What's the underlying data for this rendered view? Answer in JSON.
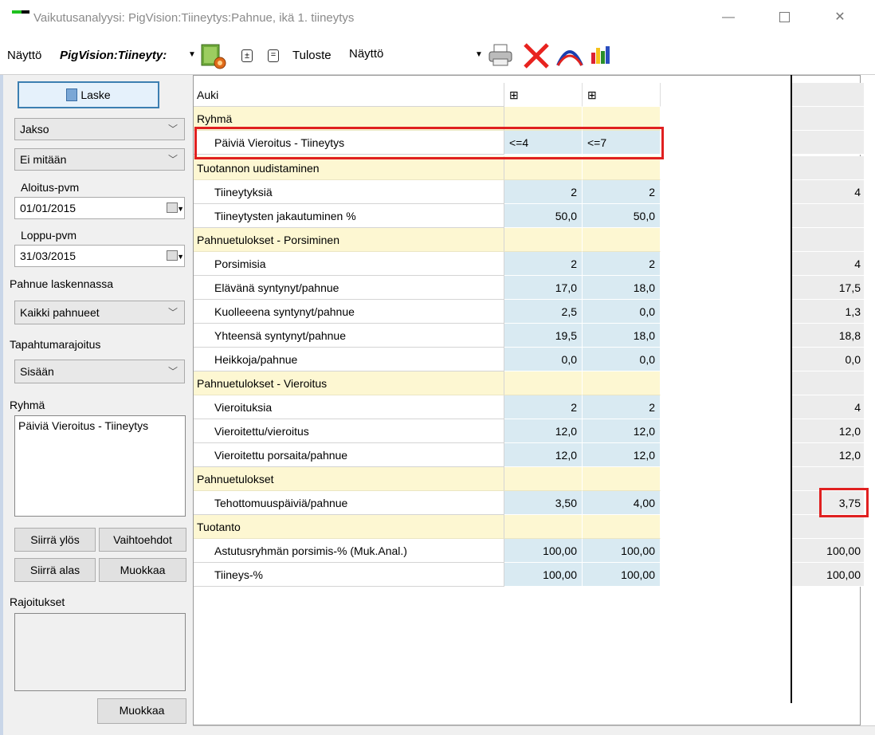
{
  "window": {
    "title": "Vaikutusanalyysi: PigVision:Tiineytys:Pahnue, ikä 1. tiineytys",
    "minimize": "—",
    "close": "✕"
  },
  "toolbar": {
    "view_label": "Näyttö",
    "profile": "PigVision:Tiineyty:",
    "expand": "±",
    "collapse": "=",
    "print_label": "Tuloste",
    "output": "Näyttö",
    "icons": [
      "gear-icon",
      "expand-icon",
      "collapse-icon",
      "printer-icon",
      "delete-icon",
      "curve-icon",
      "bar-chart-icon"
    ]
  },
  "left": {
    "calc_button": "Laske",
    "period_select": "Jakso",
    "none_select": "Ei mitään",
    "start_label": "Aloitus-pvm",
    "start_date": "01/01/2015",
    "end_label": "Loppu-pvm",
    "end_date": "31/03/2015",
    "litter_label": "Pahnue laskennassa",
    "litter_select": "Kaikki pahnueet",
    "event_label": "Tapahtumarajoitus",
    "event_select": "Sisään",
    "group_label": "Ryhmä",
    "group_item": "Päiviä Vieroitus - Tiineytys",
    "move_up": "Siirrä ylös",
    "options": "Vaihtoehdot",
    "move_down": "Siirrä alas",
    "edit1": "Muokkaa",
    "restrictions_label": "Rajoitukset",
    "edit2": "Muokkaa"
  },
  "grid": {
    "rows": [
      {
        "label": "Auki",
        "v1": "⊞",
        "v2": "⊞",
        "sum": ""
      },
      {
        "label": "Ryhmä",
        "v1": "",
        "v2": "",
        "sum": ""
      },
      {
        "label": "Päiviä Vieroitus - Tiineytys",
        "v1": "<=4",
        "v2": "<=7",
        "sum": ""
      },
      {
        "label": "Tuotannon uudistaminen",
        "v1": "",
        "v2": "",
        "sum": ""
      },
      {
        "label": "Tiineytyksiä",
        "v1": "2",
        "v2": "2",
        "sum": "4"
      },
      {
        "label": "Tiineytysten jakautuminen %",
        "v1": "50,0",
        "v2": "50,0",
        "sum": ""
      },
      {
        "label": "Pahnuetulokset - Porsiminen",
        "v1": "",
        "v2": "",
        "sum": ""
      },
      {
        "label": "Porsimisia",
        "v1": "2",
        "v2": "2",
        "sum": "4"
      },
      {
        "label": "Elävänä syntynyt/pahnue",
        "v1": "17,0",
        "v2": "18,0",
        "sum": "17,5"
      },
      {
        "label": "Kuolleeena syntynyt/pahnue",
        "v1": "2,5",
        "v2": "0,0",
        "sum": "1,3"
      },
      {
        "label": "Yhteensä syntynyt/pahnue",
        "v1": "19,5",
        "v2": "18,0",
        "sum": "18,8"
      },
      {
        "label": "Heikkoja/pahnue",
        "v1": "0,0",
        "v2": "0,0",
        "sum": "0,0"
      },
      {
        "label": "Pahnuetulokset - Vieroitus",
        "v1": "",
        "v2": "",
        "sum": ""
      },
      {
        "label": "Vieroituksia",
        "v1": "2",
        "v2": "2",
        "sum": "4"
      },
      {
        "label": "Vieroitettu/vieroitus",
        "v1": "12,0",
        "v2": "12,0",
        "sum": "12,0"
      },
      {
        "label": "Vieroitettu porsaita/pahnue",
        "v1": "12,0",
        "v2": "12,0",
        "sum": "12,0"
      },
      {
        "label": "Pahnuetulokset",
        "v1": "",
        "v2": "",
        "sum": ""
      },
      {
        "label": "Tehottomuuspäiviä/pahnue",
        "v1": "3,50",
        "v2": "4,00",
        "sum": "3,75"
      },
      {
        "label": "Tuotanto",
        "v1": "",
        "v2": "",
        "sum": ""
      },
      {
        "label": "Astutusryhmän porsimis-% (Muk.Anal.)",
        "v1": "100,00",
        "v2": "100,00",
        "sum": "100,00"
      },
      {
        "label": "Tiineys-%",
        "v1": "100,00",
        "v2": "100,00",
        "sum": "100,00"
      }
    ]
  },
  "colors": {
    "header_row": "#fdf7d2",
    "value_cell": "#d9eaf2",
    "highlight": "#e02020"
  }
}
